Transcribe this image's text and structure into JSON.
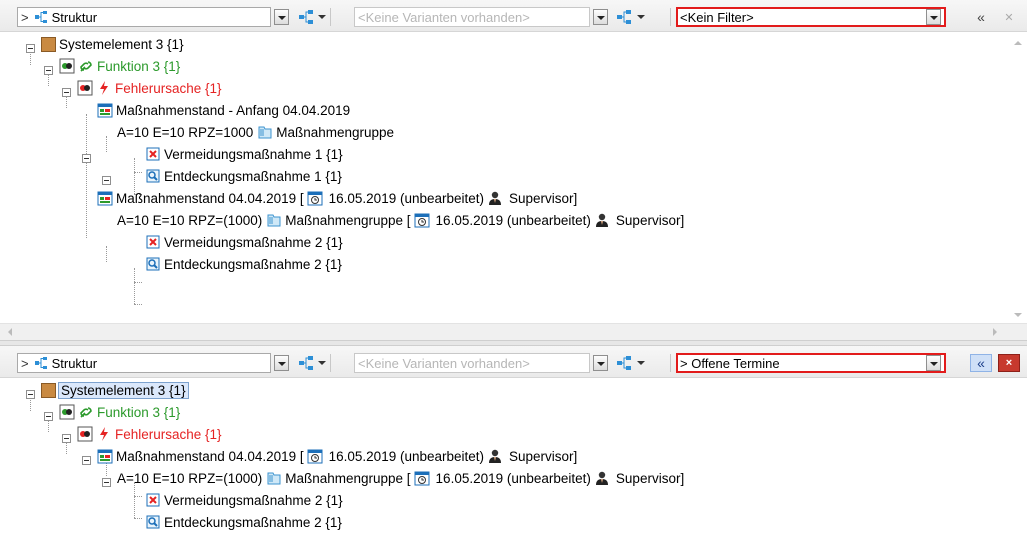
{
  "panes": [
    {
      "view_combo": {
        "prefix": ">",
        "label": "Struktur"
      },
      "variant_combo": {
        "label": "<Keine Varianten vorhanden>"
      },
      "filter_combo": {
        "label": "<Kein Filter>"
      },
      "collapse_glyph": "«",
      "close_glyph": "✕",
      "tree": [
        {
          "text": "Systemelement 3 {1}"
        },
        {
          "text": "Funktion 3 {1}"
        },
        {
          "text": "Fehlerursache {1}"
        },
        {
          "text": "Maßnahmenstand - Anfang 04.04.2019"
        },
        {
          "text": "A=10 E=10 RPZ=1000",
          "after": "Maßnahmengruppe"
        },
        {
          "text": "Vermeidungsmaßnahme 1 {1}"
        },
        {
          "text": "Entdeckungsmaßnahme 1 {1}"
        },
        {
          "text": "Maßnahmenstand 04.04.2019 [",
          "date": "16.05.2019 (unbearbeitet)",
          "user": "Supervisor]"
        },
        {
          "text": "A=10 E=10 RPZ=(1000)",
          "after": "Maßnahmengruppe [",
          "date": "16.05.2019 (unbearbeitet)",
          "user": "Supervisor]"
        },
        {
          "text": "Vermeidungsmaßnahme 2 {1}"
        },
        {
          "text": "Entdeckungsmaßnahme 2 {1}"
        }
      ]
    },
    {
      "view_combo": {
        "prefix": ">",
        "label": "Struktur"
      },
      "variant_combo": {
        "label": "<Keine Varianten vorhanden>"
      },
      "filter_combo": {
        "label": "> Offene Termine"
      },
      "collapse_glyph": "«",
      "close_glyph": "×",
      "tree": [
        {
          "text": "Systemelement 3 {1}"
        },
        {
          "text": "Funktion 3 {1}"
        },
        {
          "text": "Fehlerursache {1}"
        },
        {
          "text": "Maßnahmenstand 04.04.2019 [",
          "date": "16.05.2019 (unbearbeitet)",
          "user": "Supervisor]"
        },
        {
          "text": "A=10 E=10 RPZ=(1000)",
          "after": "Maßnahmengruppe [",
          "date": "16.05.2019 (unbearbeitet)",
          "user": "Supervisor]"
        },
        {
          "text": "Vermeidungsmaßnahme 2 {1}"
        },
        {
          "text": "Entdeckungsmaßnahme 2 {1}"
        }
      ]
    }
  ],
  "colors": {
    "function_text": "#2c9a2c",
    "cause_text": "#e52323",
    "filter_border": "#e21b1b",
    "selection": "#dbe8fb"
  },
  "icons": {
    "system_element": "system-element-icon",
    "function": "function-link-icon",
    "cause": "lightning-icon",
    "measure_state": "calendar-icon",
    "measure_group": "folder-icon",
    "prevention": "prevention-x-icon",
    "detection": "detection-magnifier-icon",
    "date": "calendar-clock-icon",
    "user": "user-icon",
    "tree_structure": "tree-structure-icon"
  }
}
